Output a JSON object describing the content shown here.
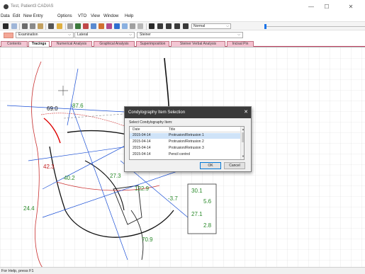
{
  "window": {
    "title": "Test, Patient3 CADIAS",
    "minimize_glyph": "—",
    "maximize_glyph": "☐",
    "close_glyph": "✕"
  },
  "menu": [
    "Data",
    "Edit",
    "New Entry",
    "Options",
    "VTO",
    "View",
    "Window",
    "Help"
  ],
  "toolbar": {
    "zoom_select": "Normal",
    "icons": [
      "save-icon",
      "print-preview-icon",
      "cut-icon",
      "copy-icon",
      "paste-icon",
      "print-icon",
      "help-icon",
      "tracing-icon",
      "compare-icon",
      "analysis-icon",
      "superimpose-icon",
      "measure-icon",
      "play-icon",
      "pause-icon",
      "stop-icon",
      "rewind-icon",
      "forward-icon"
    ]
  },
  "selectors": {
    "examination": "Examination",
    "view": "Lateral",
    "analysis": "Steiner",
    "exam_color": "#f4a797"
  },
  "tabs": [
    {
      "label": "Contents",
      "active": false
    },
    {
      "label": "Tracings",
      "active": true
    },
    {
      "label": "Numerical Analysis",
      "active": false
    },
    {
      "label": "Graphical Analysis",
      "active": false
    },
    {
      "label": "Superimposition",
      "active": false
    },
    {
      "label": "Steiner Verbal Analysis",
      "active": false
    },
    {
      "label": "Incisal Pin",
      "active": false
    }
  ],
  "tracing_labels": {
    "angle_69": "69.0",
    "angle_87": "87.6",
    "value_42": "42.3",
    "value_40": "40.2",
    "value_27": "27.3",
    "value_122": "122.9",
    "value_neg37": "-3.7",
    "value_24": "24.4",
    "value_70": "70.9",
    "box_301": "30.1",
    "box_56": "5.6",
    "box_271": "27.1",
    "box_28": "2.8"
  },
  "dialog": {
    "title": "Condylography Item Selection",
    "close_glyph": "✕",
    "prompt": "Select Condylography Item:",
    "col_date": "Date",
    "col_title": "Title",
    "rows": [
      {
        "date": "2015-04-14",
        "title": "Protrusion/Retrusion 1",
        "selected": true
      },
      {
        "date": "2015-04-14",
        "title": "Protrusion/Retrusion 2",
        "selected": false
      },
      {
        "date": "2015-04-14",
        "title": "Protrusion/Retrusion 3",
        "selected": false
      },
      {
        "date": "2015-04-14",
        "title": "Pencil control",
        "selected": false
      }
    ],
    "ok_label": "OK",
    "cancel_label": "Cancel"
  },
  "status": "For Help, press F1"
}
